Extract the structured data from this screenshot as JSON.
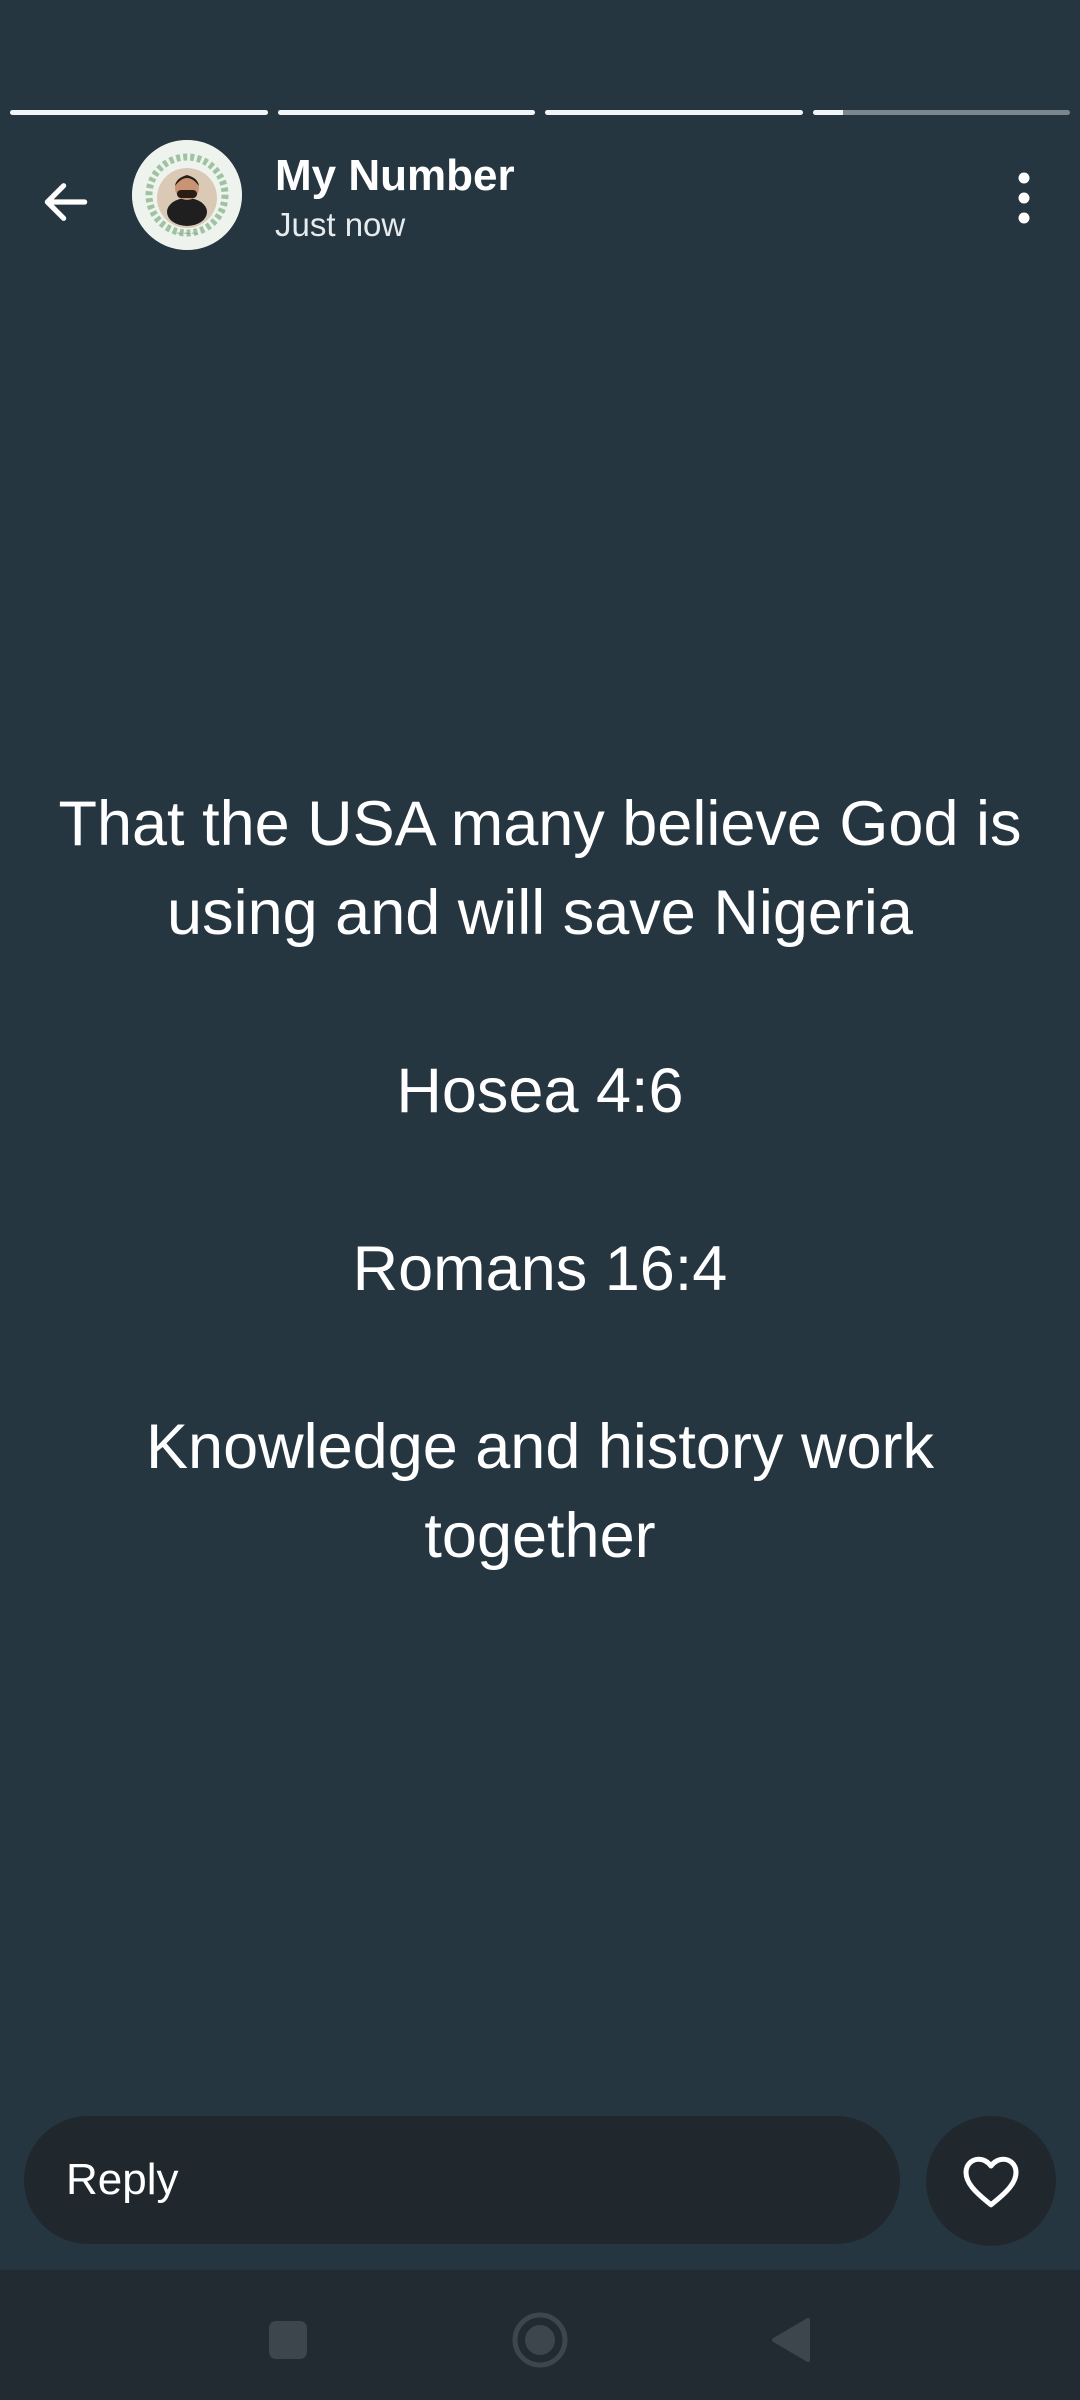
{
  "progress": {
    "segments": [
      1,
      1,
      1,
      0.12
    ]
  },
  "header": {
    "contact_name": "My Number",
    "time": "Just now",
    "back_icon": "arrow-left-icon",
    "menu_icon": "more-vertical-icon"
  },
  "status": {
    "paragraphs": [
      "That the USA many believe God is using and will save Nigeria",
      "Hosea 4:6",
      "Romans 16:4",
      "Knowledge and history work together"
    ]
  },
  "reply": {
    "placeholder": "Reply",
    "like_icon": "heart-icon"
  },
  "navbar": {
    "recents_icon": "square-icon",
    "home_icon": "circle-icon",
    "back_icon": "triangle-back-icon"
  },
  "colors": {
    "background": "#263641",
    "field": "#20282d",
    "navbar": "#212b31"
  }
}
